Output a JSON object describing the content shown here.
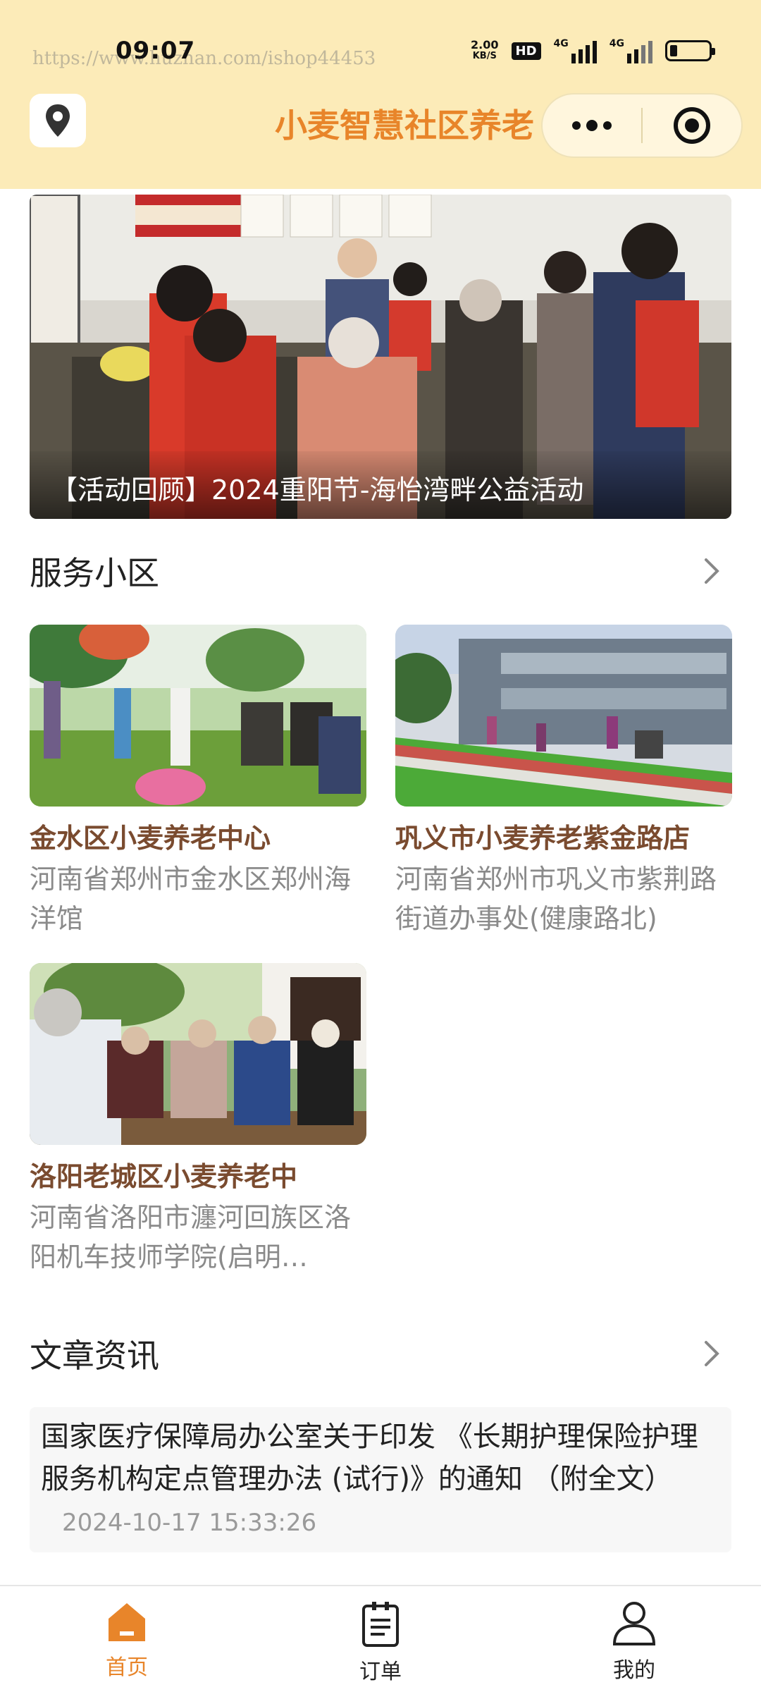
{
  "status_bar": {
    "time": "09:07",
    "net_speed_value": "2.00",
    "net_speed_unit": "KB/S",
    "hd_badge": "HD",
    "signal1_label": "4G",
    "signal2_label": "4G"
  },
  "watermark": "https://www.huzhan.com/ishop44453",
  "header": {
    "title": "小麦智慧社区养老",
    "location_icon": "location-pin-icon",
    "more_icon": "more-dots-icon",
    "target_icon": "target-icon"
  },
  "banner": {
    "caption": "【活动回顾】2024重阳节-海怡湾畔公益活动"
  },
  "communities": {
    "title": "服务小区",
    "items": [
      {
        "name": "金水区小麦养老中心",
        "address": "河南省郑州市金水区郑州海洋馆"
      },
      {
        "name": "巩义市小麦养老紫金路店",
        "address": "河南省郑州市巩义市紫荆路街道办事处(健康路北)"
      },
      {
        "name": "洛阳老城区小麦养老中",
        "address": "河南省洛阳市瀍河回族区洛阳机车技师学院(启明…"
      }
    ]
  },
  "articles": {
    "title": "文章资讯",
    "items": [
      {
        "title": "国家医疗保障局办公室关于印发 《长期护理保险护理服务机构定点管理办法 (试行)》的通知 （附全文）",
        "time": "2024-10-17 15:33:26"
      }
    ]
  },
  "tabbar": {
    "items": [
      {
        "label": "首页",
        "icon": "home-icon",
        "active": true
      },
      {
        "label": "订单",
        "icon": "order-clipboard-icon",
        "active": false
      },
      {
        "label": "我的",
        "icon": "user-icon",
        "active": false
      }
    ]
  },
  "colors": {
    "header_bg": "#fcebb8",
    "accent": "#e8852a",
    "card_title": "#7a4b2f"
  }
}
